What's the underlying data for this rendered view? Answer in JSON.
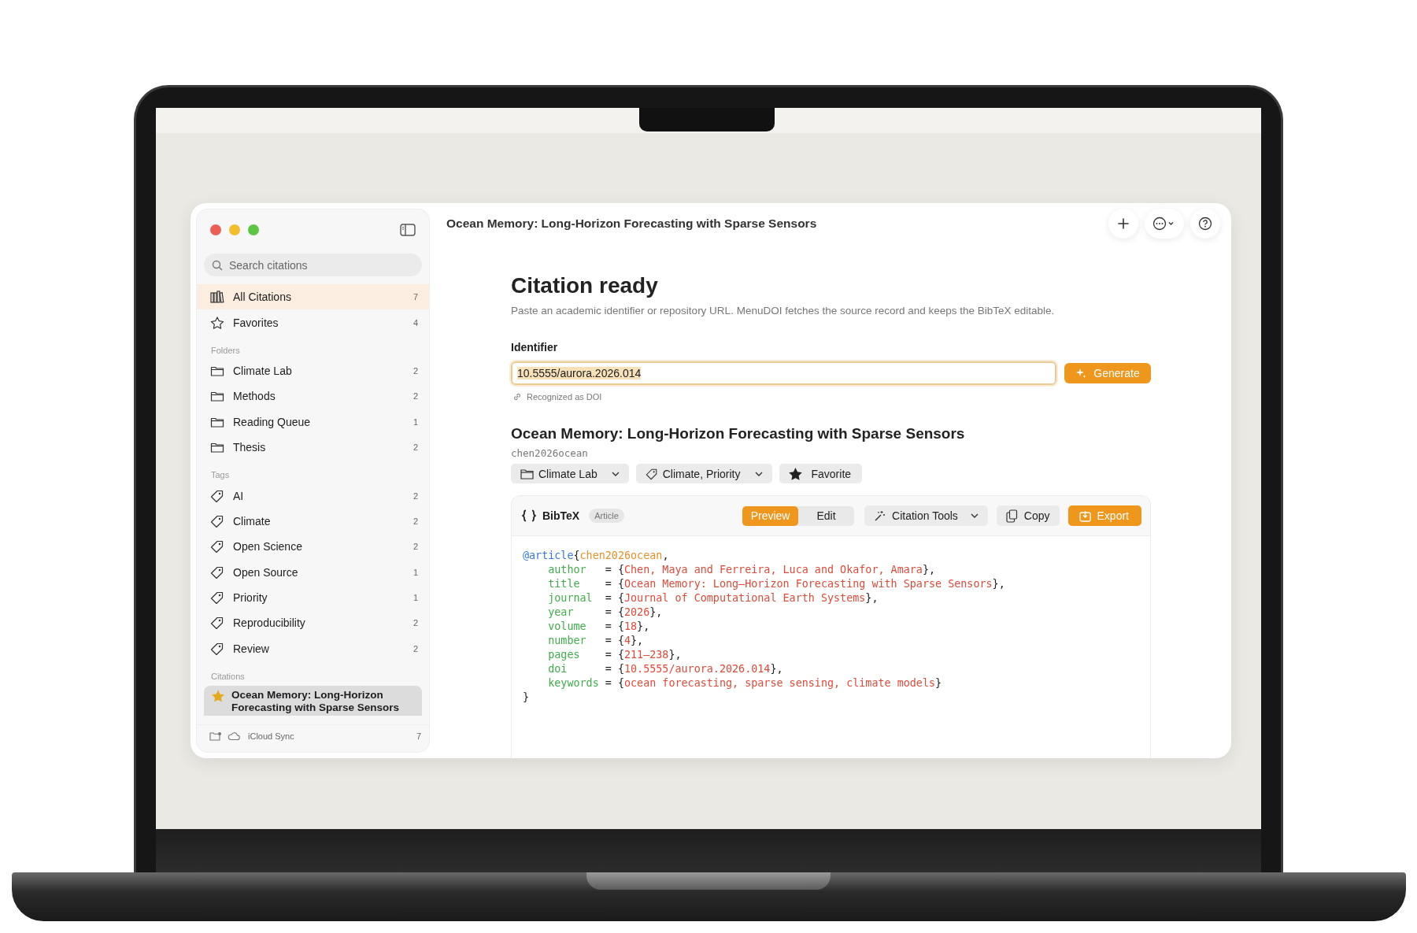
{
  "window": {
    "title": "Ocean Memory: Long-Horizon Forecasting with Sparse Sensors"
  },
  "sidebar": {
    "search": {
      "placeholder": "Search citations"
    },
    "items": [
      {
        "kind": "library",
        "label": "All Citations",
        "count": "7",
        "selected": true
      },
      {
        "kind": "favorites",
        "label": "Favorites",
        "count": "4",
        "selected": false
      }
    ],
    "sections": [
      {
        "title": "Folders",
        "kind": "folder",
        "items": [
          {
            "label": "Climate Lab",
            "count": "2",
            "selected": false
          },
          {
            "label": "Methods",
            "count": "2",
            "selected": false
          },
          {
            "label": "Reading Queue",
            "count": "1",
            "selected": false
          },
          {
            "label": "Thesis",
            "count": "2",
            "selected": false
          }
        ]
      },
      {
        "title": "Tags",
        "kind": "tag",
        "items": [
          {
            "label": "AI",
            "count": "2",
            "selected": false
          },
          {
            "label": "Climate",
            "count": "2",
            "selected": false
          },
          {
            "label": "Open Science",
            "count": "2",
            "selected": false
          },
          {
            "label": "Open Source",
            "count": "1",
            "selected": false
          },
          {
            "label": "Priority",
            "count": "1",
            "selected": false
          },
          {
            "label": "Reproducibility",
            "count": "2",
            "selected": false
          },
          {
            "label": "Review",
            "count": "2",
            "selected": false
          }
        ]
      }
    ],
    "citations": {
      "title": "Citations",
      "items": [
        {
          "title": "Ocean Memory: Long-Horizon Forecasting with Sparse Sensors",
          "favorite": true,
          "selected": true
        }
      ]
    },
    "footer": {
      "label": "iCloud Sync",
      "count": "7"
    }
  },
  "main": {
    "heading": "Citation ready",
    "description": "Paste an academic identifier or repository URL. MenuDOI fetches the source record and keeps the BibTeX editable.",
    "identifier": {
      "label": "Identifier",
      "value": "10.5555/aurora.2026.014",
      "button": "Generate",
      "hint": "Recognized as DOI"
    },
    "citation": {
      "title": "Ocean Memory: Long-Horizon Forecasting with Sparse Sensors",
      "key": "chen2026ocean",
      "chips": [
        {
          "kind": "folder",
          "label": "Climate Lab",
          "dropdown": true
        },
        {
          "kind": "tags",
          "label": "Climate, Priority",
          "dropdown": true
        },
        {
          "kind": "favorite",
          "label": "Favorite",
          "on": true
        }
      ]
    },
    "bibtex": {
      "title": "BibTeX",
      "badge": "Article",
      "tabs": [
        {
          "label": "Preview",
          "selected": true
        },
        {
          "label": "Edit",
          "selected": false
        }
      ],
      "tools": "Citation Tools",
      "copy": "Copy",
      "export": "Export",
      "lines": [
        {
          "indented": false,
          "tokens": [
            {
              "kind": "type",
              "text": "@article"
            },
            {
              "kind": "punct",
              "text": "{"
            },
            {
              "kind": "key",
              "text": "chen2026ocean"
            },
            {
              "kind": "punct",
              "text": ","
            }
          ]
        },
        {
          "indented": true,
          "tokens": [
            {
              "kind": "field",
              "text": "author"
            },
            {
              "kind": "punct",
              "text": "   = {"
            },
            {
              "kind": "value",
              "text": "Chen, Maya and Ferreira, Luca and Okafor, Amara"
            },
            {
              "kind": "punct",
              "text": "},"
            }
          ]
        },
        {
          "indented": true,
          "tokens": [
            {
              "kind": "field",
              "text": "title"
            },
            {
              "kind": "punct",
              "text": "    = {"
            },
            {
              "kind": "value",
              "text": "Ocean Memory: Long–Horizon Forecasting with Sparse Sensors"
            },
            {
              "kind": "punct",
              "text": "},"
            }
          ]
        },
        {
          "indented": true,
          "tokens": [
            {
              "kind": "field",
              "text": "journal"
            },
            {
              "kind": "punct",
              "text": "  = {"
            },
            {
              "kind": "value",
              "text": "Journal of Computational Earth Systems"
            },
            {
              "kind": "punct",
              "text": "},"
            }
          ]
        },
        {
          "indented": true,
          "tokens": [
            {
              "kind": "field",
              "text": "year"
            },
            {
              "kind": "punct",
              "text": "     = {"
            },
            {
              "kind": "value",
              "text": "2026"
            },
            {
              "kind": "punct",
              "text": "},"
            }
          ]
        },
        {
          "indented": true,
          "tokens": [
            {
              "kind": "field",
              "text": "volume"
            },
            {
              "kind": "punct",
              "text": "   = {"
            },
            {
              "kind": "value",
              "text": "18"
            },
            {
              "kind": "punct",
              "text": "},"
            }
          ]
        },
        {
          "indented": true,
          "tokens": [
            {
              "kind": "field",
              "text": "number"
            },
            {
              "kind": "punct",
              "text": "   = {"
            },
            {
              "kind": "value",
              "text": "4"
            },
            {
              "kind": "punct",
              "text": "},"
            }
          ]
        },
        {
          "indented": true,
          "tokens": [
            {
              "kind": "field",
              "text": "pages"
            },
            {
              "kind": "punct",
              "text": "    = {"
            },
            {
              "kind": "value",
              "text": "211–238"
            },
            {
              "kind": "punct",
              "text": "},"
            }
          ]
        },
        {
          "indented": true,
          "tokens": [
            {
              "kind": "field",
              "text": "doi"
            },
            {
              "kind": "punct",
              "text": "      = {"
            },
            {
              "kind": "value",
              "text": "10.5555/aurora.2026.014"
            },
            {
              "kind": "punct",
              "text": "},"
            }
          ]
        },
        {
          "indented": true,
          "tokens": [
            {
              "kind": "field",
              "text": "keywords"
            },
            {
              "kind": "punct",
              "text": " = {"
            },
            {
              "kind": "value",
              "text": "ocean forecasting, sparse sensing, climate models"
            },
            {
              "kind": "punct",
              "text": "}"
            }
          ]
        },
        {
          "indented": false,
          "tokens": [
            {
              "kind": "punct",
              "text": "}"
            }
          ]
        }
      ]
    }
  }
}
